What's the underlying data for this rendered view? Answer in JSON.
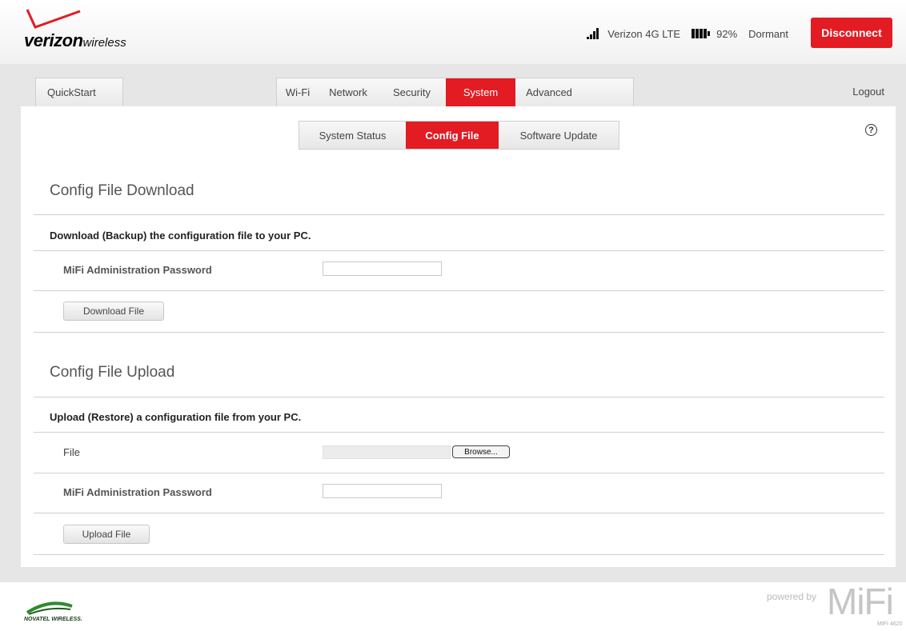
{
  "header": {
    "logo_bold": "verizon",
    "logo_light": "wireless",
    "network_name": "Verizon 4G LTE",
    "battery_percent": "92%",
    "connection_state": "Dormant",
    "disconnect_label": "Disconnect",
    "signal_bars": 4,
    "battery_bars": 4
  },
  "nav": {
    "quickstart_label": "QuickStart",
    "tabs": [
      {
        "label": "Wi-Fi",
        "active": false
      },
      {
        "label": "Network",
        "active": false
      },
      {
        "label": "Security",
        "active": false
      },
      {
        "label": "System",
        "active": true
      },
      {
        "label": "Advanced",
        "active": false
      }
    ],
    "logout_label": "Logout"
  },
  "subnav": {
    "tabs": [
      {
        "label": "System Status",
        "active": false
      },
      {
        "label": "Config File",
        "active": true
      },
      {
        "label": "Software Update",
        "active": false
      }
    ],
    "help_glyph": "?"
  },
  "download": {
    "title": "Config File Download",
    "description": "Download (Backup) the configuration file to your PC.",
    "password_label": "MiFi Administration Password",
    "password_value": "",
    "button_label": "Download File"
  },
  "upload": {
    "title": "Config File Upload",
    "description": "Upload (Restore) a configuration file from your PC.",
    "file_label": "File",
    "file_value": "",
    "browse_label": "Browse...",
    "password_label": "MiFi Administration Password",
    "password_value": "",
    "button_label": "Upload File"
  },
  "footer": {
    "vendor_logo": "NOVATEL WIRELESS.",
    "powered_by": "powered by",
    "product_logo": "MiFi",
    "model": "MIFI 4620"
  },
  "colors": {
    "accent": "#e31b23",
    "band": "#e6e6e6"
  }
}
